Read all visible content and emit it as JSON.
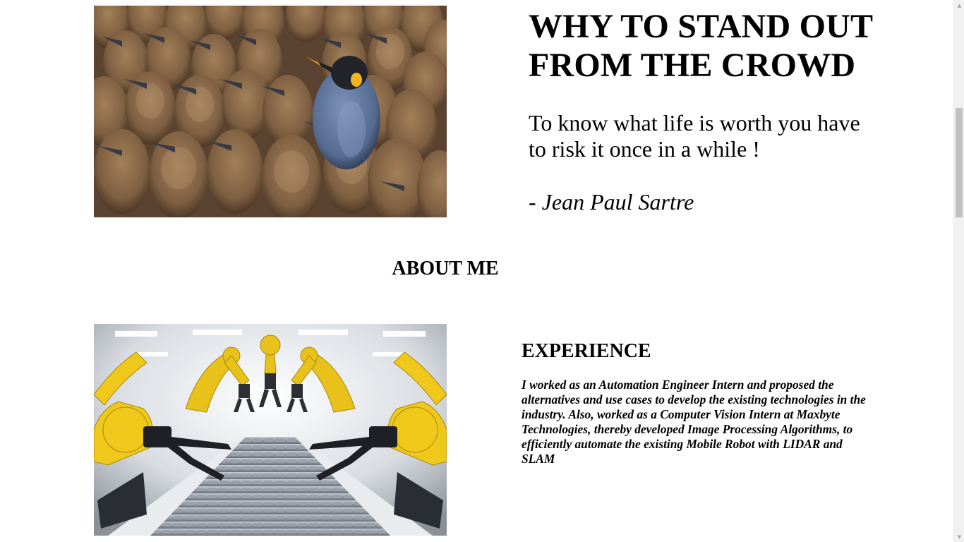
{
  "hero": {
    "title": "WHY TO STAND OUT FROM THE CROWD",
    "quote": "To know what life is worth you have to risk it once in a while !",
    "author_prefix": "- ",
    "author_name": "Jean Paul Sartre"
  },
  "about": {
    "heading": "ABOUT ME"
  },
  "experience": {
    "heading": "EXPERIENCE",
    "text": "I worked as an Automation Engineer Intern and proposed the alternatives and use cases to develop the existing technologies in the industry. Also, worked as a Computer Vision Intern at Maxbyte Technologies, thereby developed Image Processing Algorithms, to efficiently automate the existing Mobile Robot with LIDAR and SLAM"
  },
  "images": {
    "hero_icon": "penguin-crowd-image",
    "experience_icon": "robotic-arms-conveyor-image"
  },
  "colors": {
    "penguin_brown": "#8a6a4a",
    "penguin_blue": "#5f7598",
    "robot_yellow": "#e8c21a",
    "conveyor_gray": "#8d95a0",
    "scrollbar_thumb": "#c1c1c1"
  }
}
